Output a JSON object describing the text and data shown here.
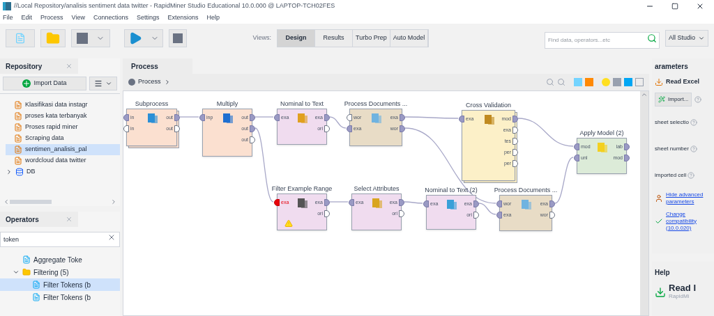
{
  "window": {
    "title": "//Local Repository/analisis sentiment data twitter - RapidMiner Studio Educational 10.0.000 @ LAPTOP-TCH02FES"
  },
  "menu": [
    "File",
    "Edit",
    "Process",
    "View",
    "Connections",
    "Settings",
    "Extensions",
    "Help"
  ],
  "views": {
    "label": "Views:",
    "tabs": [
      {
        "label": "Design",
        "selected": true
      },
      {
        "label": "Results",
        "selected": false
      },
      {
        "label": "Turbo Prep",
        "selected": false
      },
      {
        "label": "Auto Model",
        "selected": false
      }
    ]
  },
  "search": {
    "placeholder": "Find data, operators...etc",
    "scope": "All Studio"
  },
  "repository": {
    "title": "Repository",
    "import_button": "Import Data",
    "items": [
      {
        "label": "Klasifikasi data instagr",
        "kind": "process",
        "selected": false
      },
      {
        "label": "proses kata terbanyak",
        "kind": "process",
        "selected": false
      },
      {
        "label": "Proses rapid miner",
        "kind": "process",
        "selected": false
      },
      {
        "label": "Scraping data",
        "kind": "process",
        "selected": false
      },
      {
        "label": "sentimen_analisis_pal",
        "kind": "process",
        "selected": true
      },
      {
        "label": "wordcloud data twitter",
        "kind": "process",
        "selected": false
      },
      {
        "label": "DB",
        "kind": "database",
        "selected": false
      }
    ]
  },
  "operators": {
    "title": "Operators",
    "query": "token",
    "items": [
      {
        "label": "Aggregate Toke",
        "kind": "operator",
        "selected": false
      },
      {
        "label": "Filtering (5)",
        "kind": "folder",
        "expanded": true,
        "selected": false,
        "children": [
          {
            "label": "Filter Tokens (b",
            "kind": "operator",
            "selected": true
          },
          {
            "label": "Filter Tokens (b",
            "kind": "operator",
            "selected": false
          }
        ]
      }
    ]
  },
  "process": {
    "tab": "Process",
    "breadcrumb": "Process",
    "nodes": [
      {
        "name": "Subprocess",
        "kind": "subprocess",
        "color": "#fbe0d0",
        "warning": false,
        "inputs": [
          {
            "label": "in",
            "connected": true
          },
          {
            "label": "in",
            "connected": false
          }
        ],
        "outputs": [
          {
            "label": "out",
            "connected": true
          },
          {
            "label": "out",
            "connected": false
          }
        ]
      },
      {
        "name": "Multiply",
        "kind": "operator",
        "color": "#fbe0d0",
        "warning": false,
        "inputs": [
          {
            "label": "inp",
            "connected": true
          }
        ],
        "outputs": [
          {
            "label": "out",
            "connected": true
          },
          {
            "label": "out",
            "connected": true
          },
          {
            "label": "out",
            "connected": false
          }
        ]
      },
      {
        "name": "Nominal to Text",
        "kind": "operator",
        "color": "#f0dcef",
        "warning": false,
        "inputs": [
          {
            "label": "exa",
            "connected": true
          }
        ],
        "outputs": [
          {
            "label": "exa",
            "connected": true
          },
          {
            "label": "ori",
            "connected": false
          }
        ]
      },
      {
        "name": "Process Documents ...",
        "kind": "operator",
        "color": "#e8dcc6",
        "warning": false,
        "inputs": [
          {
            "label": "wor",
            "connected": false
          },
          {
            "label": "exa",
            "connected": true
          }
        ],
        "outputs": [
          {
            "label": "exa",
            "connected": true
          },
          {
            "label": "wor",
            "connected": true
          }
        ]
      },
      {
        "name": "Cross Validation",
        "kind": "subprocess",
        "color": "#fcf0c8",
        "warning": false,
        "inputs": [
          {
            "label": "exa",
            "connected": true
          }
        ],
        "outputs": [
          {
            "label": "mod",
            "connected": true
          },
          {
            "label": "exa",
            "connected": false
          },
          {
            "label": "tes",
            "connected": false
          },
          {
            "label": "per",
            "connected": false
          },
          {
            "label": "per",
            "connected": false
          }
        ]
      },
      {
        "name": "Apply Model (2)",
        "kind": "operator",
        "color": "#dcebd8",
        "warning": false,
        "inputs": [
          {
            "label": "mod",
            "connected": true
          },
          {
            "label": "unl",
            "connected": true
          }
        ],
        "outputs": [
          {
            "label": "lab",
            "connected": true
          },
          {
            "label": "mod",
            "connected": true
          }
        ]
      },
      {
        "name": "Filter Example Range",
        "kind": "operator",
        "color": "#f0dcef",
        "warning": true,
        "inputs": [
          {
            "label": "exa",
            "connected": true
          }
        ],
        "outputs": [
          {
            "label": "exa",
            "connected": true
          },
          {
            "label": "ori",
            "connected": false
          }
        ]
      },
      {
        "name": "Select Attributes",
        "kind": "operator",
        "color": "#f0dcef",
        "warning": false,
        "inputs": [
          {
            "label": "exa",
            "connected": true
          }
        ],
        "outputs": [
          {
            "label": "exa",
            "connected": true
          },
          {
            "label": "ori",
            "connected": false
          }
        ]
      },
      {
        "name": "Nominal to Text (2)",
        "kind": "operator",
        "color": "#f0dcef",
        "warning": false,
        "inputs": [
          {
            "label": "exa",
            "connected": true
          }
        ],
        "outputs": [
          {
            "label": "exa",
            "connected": true
          },
          {
            "label": "ori",
            "connected": false
          }
        ]
      },
      {
        "name": "Process Documents ...",
        "kind": "operator",
        "color": "#e8dcc6",
        "warning": false,
        "inputs": [
          {
            "label": "wor",
            "connected": true
          },
          {
            "label": "exa",
            "connected": true
          }
        ],
        "outputs": [
          {
            "label": "exa",
            "connected": true
          },
          {
            "label": "wor",
            "connected": false
          }
        ]
      }
    ]
  },
  "parameters": {
    "title": "arameters",
    "operator": "Read Excel",
    "import_button": "Import...",
    "fields": [
      "sheet selectio",
      "sheet number",
      "imported cell"
    ],
    "links": [
      "Hide advanced parameters",
      "Change compatibility (10.0.020)"
    ]
  },
  "help": {
    "title": "Help",
    "heading": "Read I",
    "subtitle": "RapidMi"
  }
}
